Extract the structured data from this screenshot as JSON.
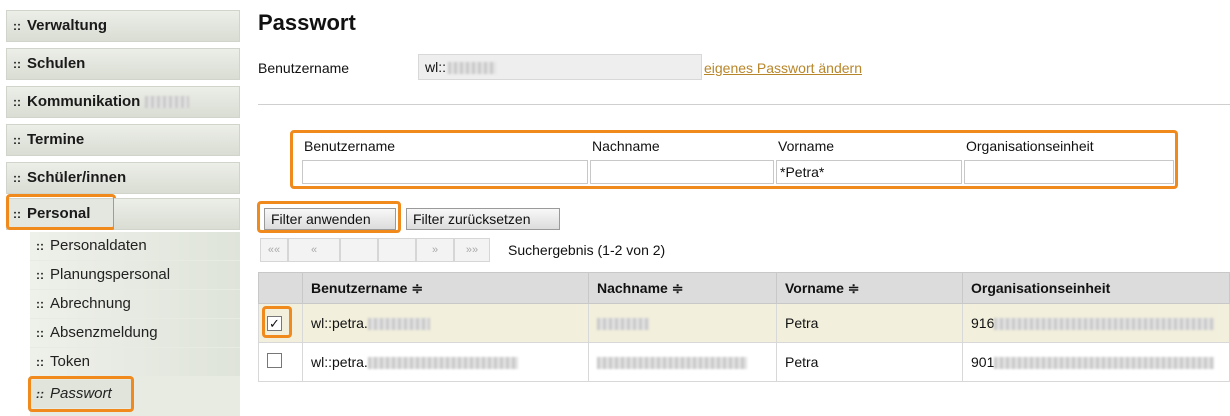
{
  "nav": {
    "items": [
      {
        "label": "Verwaltung"
      },
      {
        "label": "Schulen"
      },
      {
        "label": "Kommunikation"
      },
      {
        "label": "Termine"
      },
      {
        "label": "Schüler/innen"
      },
      {
        "label": "Personal"
      }
    ],
    "sub_items": [
      {
        "label": "Personaldaten"
      },
      {
        "label": "Planungspersonal"
      },
      {
        "label": "Abrechnung"
      },
      {
        "label": "Absenzmeldung"
      },
      {
        "label": "Token"
      },
      {
        "label": "Passwort"
      }
    ],
    "grip": "::"
  },
  "page": {
    "title": "Passwort",
    "username_label": "Benutzername",
    "username_value": "wl::",
    "change_link": "eigenes Passwort ändern"
  },
  "filter": {
    "columns": [
      "Benutzername",
      "Nachname",
      "Vorname",
      "Organisationseinheit"
    ],
    "values": [
      "",
      "",
      "*Petra*",
      ""
    ],
    "apply_label": "Filter anwenden",
    "reset_label": "Filter zurücksetzen"
  },
  "pager": {
    "first": "««",
    "prev": "«",
    "next": "»",
    "last": "»»",
    "result_text": "Suchergebnis (1-2 von 2)"
  },
  "table": {
    "headers": [
      "Benutzername ≑",
      "Nachname ≑",
      "Vorname ≑",
      "Organisationseinheit"
    ],
    "rows": [
      {
        "checked": "✓",
        "username": "wl::petra.",
        "lastname": "",
        "firstname": "Petra",
        "org": "916"
      },
      {
        "checked": "",
        "username": "wl::petra.",
        "lastname": "",
        "firstname": "Petra",
        "org": "901"
      }
    ]
  },
  "colors": {
    "highlight": "#f08a1c",
    "link": "#b8862a",
    "selected_row": "#f2efdc"
  }
}
